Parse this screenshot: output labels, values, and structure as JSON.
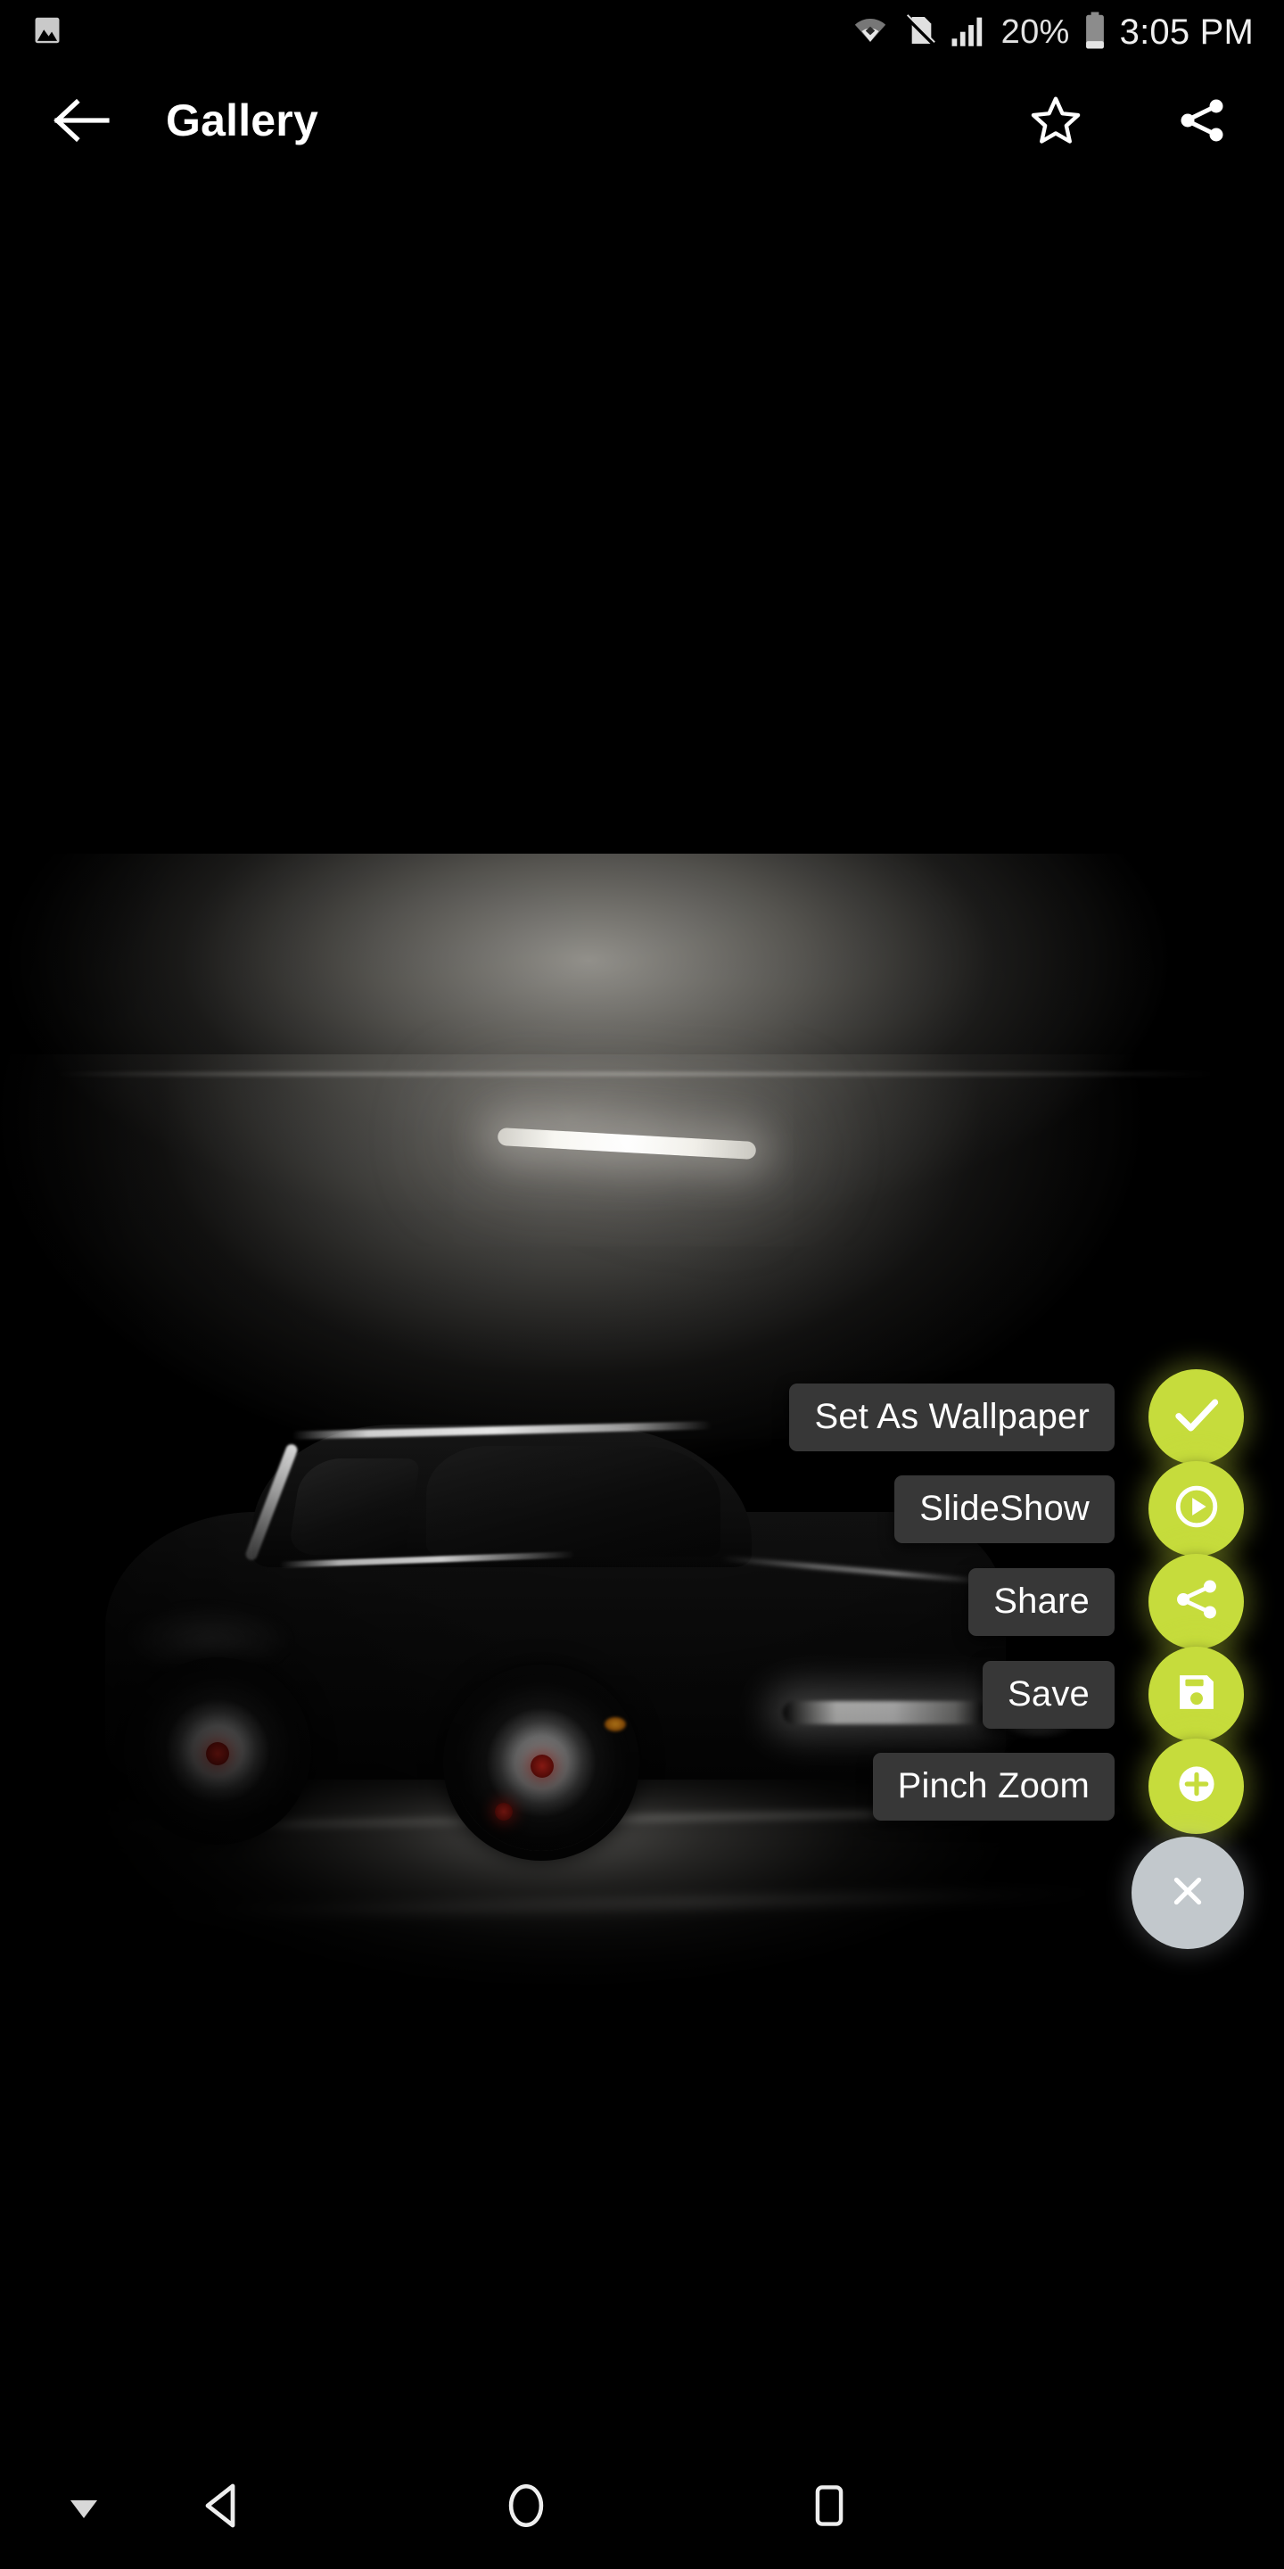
{
  "status_bar": {
    "notification_icon": "image-icon",
    "wifi_icon": "wifi-icon",
    "silent_icon": "no-sim-icon",
    "signal_icon": "cell-signal-icon",
    "battery_percent": "20%",
    "battery_icon": "battery-icon",
    "clock": "3:05 PM"
  },
  "app_bar": {
    "back_icon": "arrow-left-icon",
    "title": "Gallery",
    "favorite_icon": "star-outline-icon",
    "share_icon": "share-icon"
  },
  "photo": {
    "description": "Black sports car parked in a dark concrete garage lit by an overhead fluorescent tube"
  },
  "fab_menu": {
    "items": [
      {
        "label": "Set As Wallpaper",
        "icon": "check-icon",
        "color": "#C6DC3C"
      },
      {
        "label": "SlideShow",
        "icon": "play-circle-icon",
        "color": "#C6DC3C"
      },
      {
        "label": "Share",
        "icon": "share-icon",
        "color": "#C6DC3C"
      },
      {
        "label": "Save",
        "icon": "floppy-disk-icon",
        "color": "#C6DC3C"
      },
      {
        "label": "Pinch Zoom",
        "icon": "plus-circle-icon",
        "color": "#C6DC3C"
      }
    ],
    "close": {
      "icon": "close-icon",
      "color": "#C2C8CC"
    },
    "label_background": "#373737"
  },
  "nav_bar": {
    "hide_icon": "triangle-down-icon",
    "back_icon": "triangle-back-icon",
    "home_icon": "circle-home-icon",
    "recents_icon": "square-recents-icon"
  }
}
